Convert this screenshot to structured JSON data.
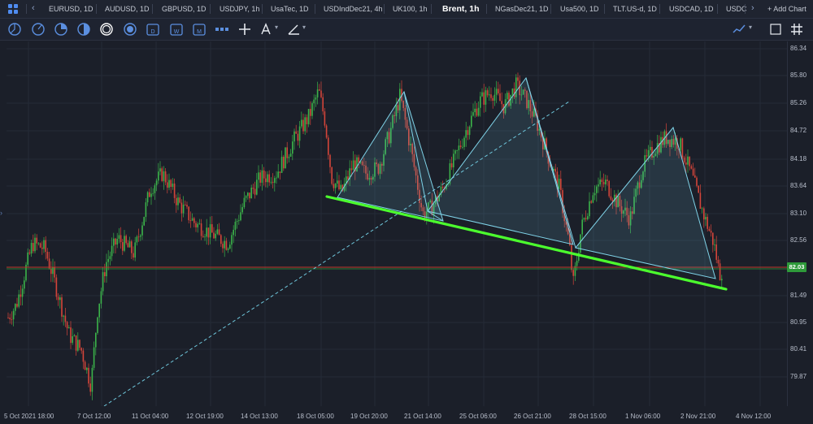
{
  "tabs": [
    {
      "label": "EURUSD, 1D",
      "active": false
    },
    {
      "label": "AUDUSD, 1D",
      "active": false
    },
    {
      "label": "GBPUSD, 1D",
      "active": false
    },
    {
      "label": "USDJPY, 1h",
      "active": false
    },
    {
      "label": "UsaTec, 1D",
      "active": false
    },
    {
      "label": "USDIndDec21, 4h",
      "active": false
    },
    {
      "label": "UK100, 1h",
      "active": false
    },
    {
      "label": "Brent, 1h",
      "active": true
    },
    {
      "label": "NGasDec21, 1D",
      "active": false
    },
    {
      "label": "Usa500, 1D",
      "active": false
    },
    {
      "label": "TLT.US-d, 1D",
      "active": false
    },
    {
      "label": "USDCAD, 1D",
      "active": false
    },
    {
      "label": "USDC",
      "active": false
    }
  ],
  "add_chart_label": "+ Add Chart",
  "toolbar_icons": [
    "circle-half-icon",
    "circle-arc-icon",
    "circle-quarter-icon",
    "circle-split-icon",
    "circle-stack-icon",
    "circle-target-icon",
    "calendar-d-icon",
    "calendar-w-icon",
    "calendar-m-icon",
    "pattern-icon",
    "crosshair-icon",
    "text-tool-icon",
    "pen-tool-icon",
    "chart-type-icon",
    "grid-icon"
  ],
  "chart_data": {
    "type": "candlestick",
    "symbol": "Brent, 1h",
    "current_price": "82.03",
    "y_ticks": [
      "86.34",
      "85.80",
      "85.26",
      "84.72",
      "84.18",
      "83.64",
      "83.10",
      "82.56",
      "82.03",
      "81.49",
      "80.95",
      "80.41",
      "79.87"
    ],
    "x_ticks": [
      "5 Oct 2021 18:00",
      "7 Oct 12:00",
      "11 Oct 04:00",
      "12 Oct 19:00",
      "14 Oct 13:00",
      "18 Oct 05:00",
      "19 Oct 20:00",
      "21 Oct 14:00",
      "25 Oct 06:00",
      "26 Oct 21:00",
      "28 Oct 15:00",
      "1 Nov 06:00",
      "2 Nov 21:00",
      "4 Nov 12:00"
    ],
    "ylim": [
      79.6,
      86.5
    ],
    "colors": {
      "up": "#3bb34a",
      "down": "#d4453a",
      "trendline": "#4cff2e",
      "triangle": "#7fd3e8",
      "hline": "#c0392b"
    },
    "grid": true
  }
}
